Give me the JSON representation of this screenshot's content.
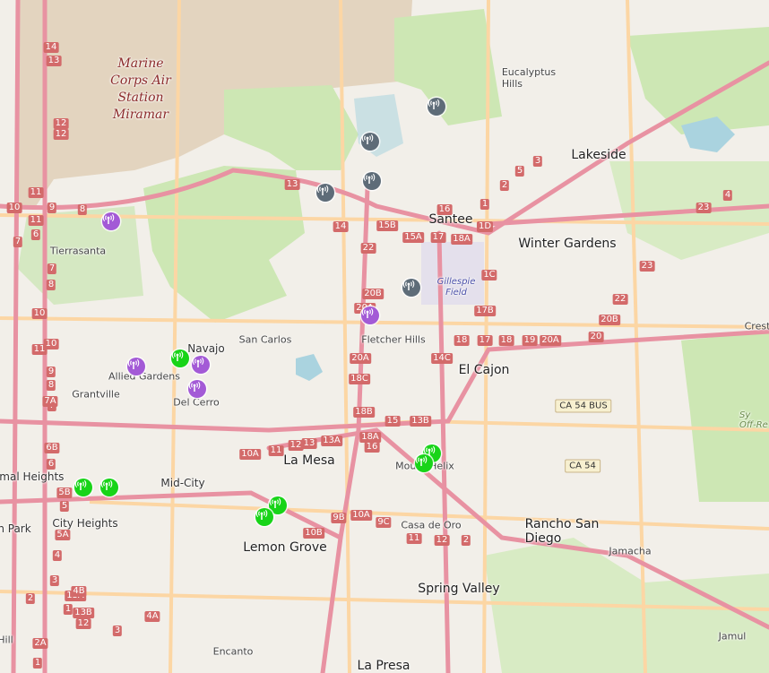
{
  "map": {
    "colors": {
      "land": "#f2efe9",
      "park": "#cde7b4",
      "military": "#e3d4bf",
      "water": "#aad3df",
      "motorway": "#e892a2",
      "primary": "#fcd6a4",
      "marker_green": "#18d418",
      "marker_purple": "#a35ad6",
      "marker_gray": "#5e6c78"
    },
    "places": [
      {
        "id": "miramar",
        "class": "mil",
        "lines": [
          "Marine",
          "Corps Air",
          "Station",
          "Miramar"
        ]
      },
      {
        "id": "eucalyptus-hills",
        "class": "small",
        "lines": [
          "Eucalyptus",
          "Hills"
        ]
      },
      {
        "id": "lakeside",
        "class": "city",
        "lines": [
          "Lakeside"
        ]
      },
      {
        "id": "santee",
        "class": "city",
        "lines": [
          "Santee"
        ]
      },
      {
        "id": "winter-gardens",
        "class": "city",
        "lines": [
          "Winter Gardens"
        ]
      },
      {
        "id": "tierrasanta",
        "class": "small",
        "lines": [
          "Tierrasanta"
        ]
      },
      {
        "id": "gillespie",
        "class": "airport",
        "lines": [
          "Gillespie",
          "Field"
        ]
      },
      {
        "id": "crest",
        "class": "small",
        "lines": [
          "Crest"
        ]
      },
      {
        "id": "san-carlos",
        "class": "small",
        "lines": [
          "San Carlos"
        ]
      },
      {
        "id": "navajo",
        "class": "town",
        "lines": [
          "Navajo"
        ]
      },
      {
        "id": "fletcher-hills",
        "class": "small",
        "lines": [
          "Fletcher Hills"
        ]
      },
      {
        "id": "allied-gardens",
        "class": "small",
        "lines": [
          "Allied Gardens"
        ]
      },
      {
        "id": "el-cajon",
        "class": "city",
        "lines": [
          "El Cajon"
        ]
      },
      {
        "id": "grantville",
        "class": "small",
        "lines": [
          "Grantville"
        ]
      },
      {
        "id": "del-cerro",
        "class": "small",
        "lines": [
          "Del Cerro"
        ]
      },
      {
        "id": "la-mesa",
        "class": "city",
        "lines": [
          "La Mesa"
        ]
      },
      {
        "id": "mount-helix",
        "class": "small",
        "lines": [
          "Mount Helix"
        ]
      },
      {
        "id": "normal-heights",
        "class": "town",
        "lines": [
          "rmal Heights"
        ]
      },
      {
        "id": "mid-city",
        "class": "town",
        "lines": [
          "Mid-City"
        ]
      },
      {
        "id": "city-heights",
        "class": "town",
        "lines": [
          "City Heights"
        ]
      },
      {
        "id": "park",
        "class": "town",
        "lines": [
          "n Park"
        ]
      },
      {
        "id": "casa-de-oro",
        "class": "small",
        "lines": [
          "Casa de Oro"
        ]
      },
      {
        "id": "rancho-san-diego",
        "class": "city",
        "lines": [
          "Rancho San",
          "Diego"
        ]
      },
      {
        "id": "lemon-grove",
        "class": "city",
        "lines": [
          "Lemon Grove"
        ]
      },
      {
        "id": "jamacha",
        "class": "small",
        "lines": [
          "Jamacha"
        ]
      },
      {
        "id": "spring-valley",
        "class": "city",
        "lines": [
          "Spring Valley"
        ]
      },
      {
        "id": "encanto",
        "class": "small",
        "lines": [
          "Encanto"
        ]
      },
      {
        "id": "la-presa",
        "class": "city",
        "lines": [
          "La Presa"
        ]
      },
      {
        "id": "jamul",
        "class": "small",
        "lines": [
          "Jamul"
        ]
      },
      {
        "id": "hill",
        "class": "small",
        "lines": [
          "Hill"
        ]
      },
      {
        "id": "offre",
        "class": "off",
        "lines": [
          "Sy",
          "Off-Re"
        ]
      }
    ],
    "route_labels": [
      {
        "id": "ca54bus",
        "text": "CA 54 BUS"
      },
      {
        "id": "ca54",
        "text": "CA 54"
      }
    ],
    "exit_numbers": [
      "14",
      "13",
      "12",
      "12",
      "11",
      "10",
      "9",
      "8",
      "7",
      "6",
      "11",
      "7",
      "8",
      "10",
      "11",
      "10",
      "9",
      "8",
      "7",
      "7A",
      "6B",
      "6",
      "5B",
      "5",
      "5A",
      "4",
      "3",
      "2",
      "1",
      "13A",
      "13B",
      "12",
      "4B",
      "4A",
      "3",
      "2A",
      "1",
      "13",
      "14",
      "15B",
      "15A",
      "17",
      "18A",
      "22",
      "20B",
      "20A",
      "20A",
      "18C",
      "18B",
      "18A",
      "16",
      "14C",
      "15",
      "13B",
      "13A",
      "13",
      "12",
      "11",
      "10A",
      "10A",
      "9C",
      "9B",
      "10B",
      "11",
      "12",
      "2",
      "1D",
      "1C",
      "17B",
      "18",
      "17",
      "18",
      "19",
      "20A",
      "20",
      "20B",
      "22",
      "23",
      "23",
      "4",
      "5",
      "3",
      "2",
      "1",
      "16"
    ],
    "markers": [
      {
        "id": "g1",
        "color": "green"
      },
      {
        "id": "g2",
        "color": "green"
      },
      {
        "id": "g3",
        "color": "green"
      },
      {
        "id": "g4",
        "color": "green"
      },
      {
        "id": "g5",
        "color": "green"
      },
      {
        "id": "g6",
        "color": "green"
      },
      {
        "id": "g7",
        "color": "green"
      },
      {
        "id": "p1",
        "color": "purple"
      },
      {
        "id": "p2",
        "color": "purple"
      },
      {
        "id": "p3",
        "color": "purple"
      },
      {
        "id": "p4",
        "color": "purple"
      },
      {
        "id": "p5",
        "color": "purple"
      },
      {
        "id": "s1",
        "color": "gray"
      },
      {
        "id": "s2",
        "color": "gray"
      },
      {
        "id": "s3",
        "color": "gray"
      },
      {
        "id": "s4",
        "color": "gray"
      },
      {
        "id": "s5",
        "color": "gray"
      }
    ],
    "marker_icon": "wifi-signal-icon"
  }
}
